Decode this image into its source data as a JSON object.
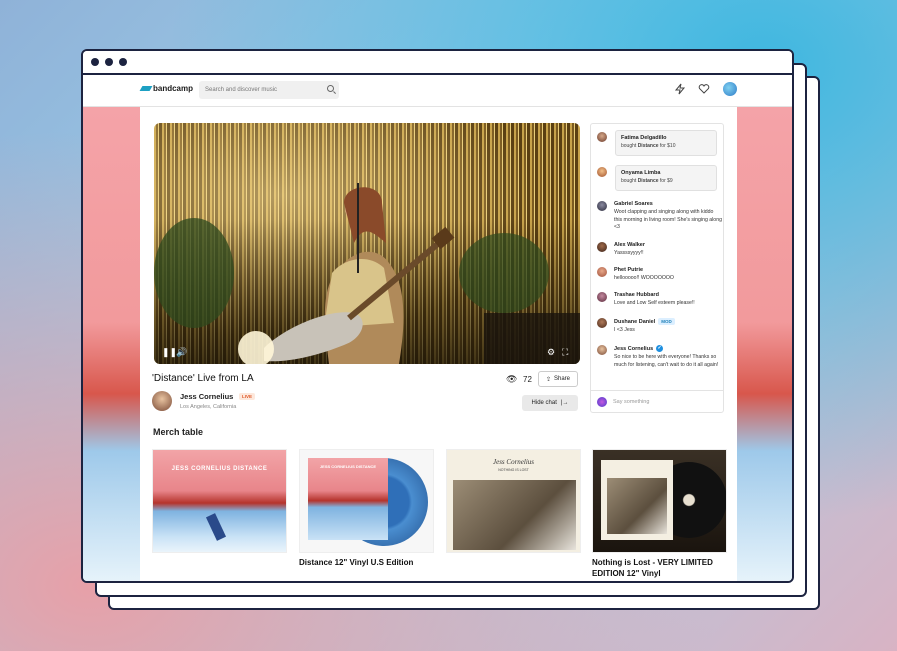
{
  "brand": {
    "name": "bandcamp",
    "accent": "#1da0c3"
  },
  "search": {
    "placeholder": "Search and discover music"
  },
  "header_icons": [
    "lightning-icon",
    "heart-icon",
    "avatar"
  ],
  "video": {
    "title": "'Distance' Live from LA",
    "viewers": "72",
    "share_label": "Share",
    "hide_chat_label": "Hide chat"
  },
  "artist": {
    "name": "Jess Cornelius",
    "live_badge": "LIVE",
    "location": "Los Angeles, California"
  },
  "purchases": [
    {
      "name": "Fatima Delgadillo",
      "verb": "bought",
      "item": "Distance",
      "price": "for $10"
    },
    {
      "name": "Onyama Limba",
      "verb": "bought",
      "item": "Distance",
      "price": "for $9"
    }
  ],
  "chat": [
    {
      "name": "Gabriel Soares",
      "text": "Woot clapping and singing along with kiddo this morning in living room! She's singing along <3"
    },
    {
      "name": "Alex Walker",
      "text": "Yassssyyyy!!"
    },
    {
      "name": "Phet Putrie",
      "text": "hellooooo!! WOOOOOOO"
    },
    {
      "name": "Trashae Hubbard",
      "text": "Love and Low Self esteem please!!"
    },
    {
      "name": "Dushane Daniel",
      "badge": "MOD",
      "text": "I <3 Jess"
    },
    {
      "name": "Jess Cornelius",
      "verified": true,
      "text": "So nice to be here with everyone! Thanks so much for listening, can't wait to do it all again!"
    }
  ],
  "chat_input": {
    "placeholder": "Say something"
  },
  "merch": {
    "heading": "Merch table",
    "cover_text": "JESS CORNELIUS  DISTANCE",
    "items": [
      {
        "title": ""
      },
      {
        "title": "Distance 12\" Vinyl U.S Edition"
      },
      {
        "title": ""
      },
      {
        "title": "Nothing is Lost - VERY LIMITED EDITION 12\" Vinyl"
      }
    ],
    "vinyl_sleeve_text": "JESS CORNELIUS  DISTANCE",
    "nil_artist": "Jess Cornelius",
    "nil_subtitle": "NOTHING IS LOST"
  }
}
